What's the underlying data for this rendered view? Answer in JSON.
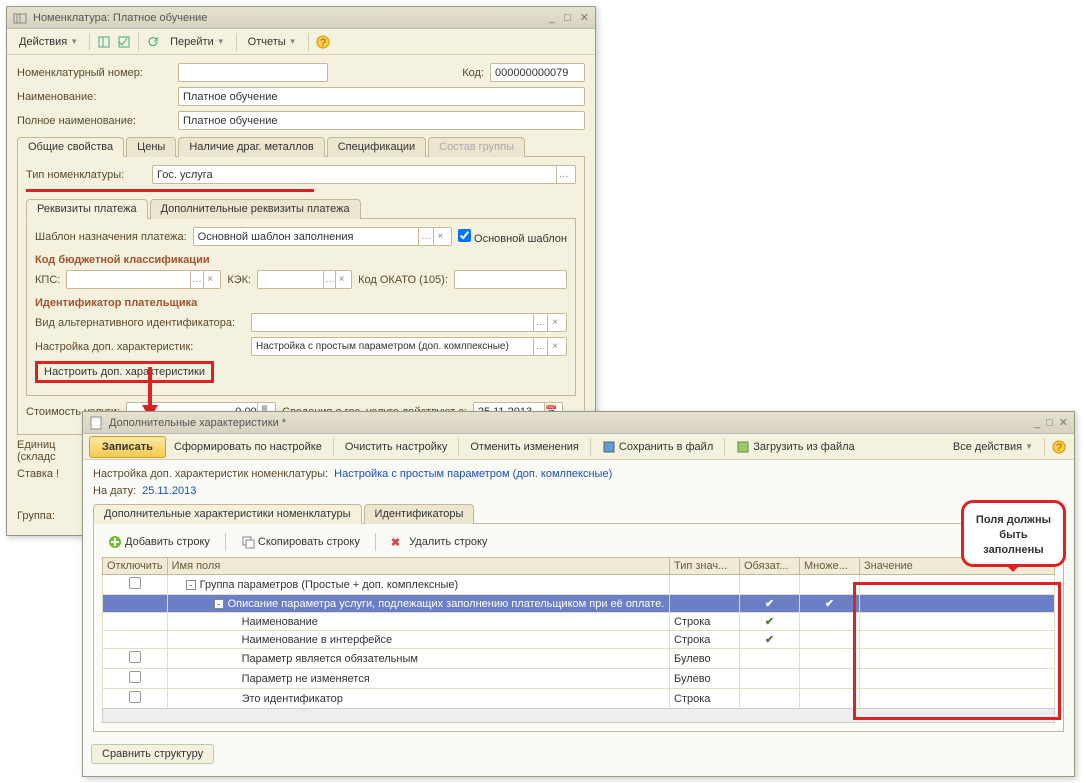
{
  "win1": {
    "title": "Номенклатура: Платное обучение",
    "toolbar": {
      "actions": "Действия",
      "goto": "Перейти",
      "reports": "Отчеты"
    },
    "fields": {
      "nom_num_lbl": "Номенклатурный номер:",
      "code_lbl": "Код:",
      "code_val": "000000000079",
      "name_lbl": "Наименование:",
      "name_val": "Платное обучение",
      "fullname_lbl": "Полное наименование:",
      "fullname_val": "Платное обучение"
    },
    "tabs": [
      "Общие свойства",
      "Цены",
      "Наличие драг. металлов",
      "Спецификации",
      "Состав группы"
    ],
    "type_lbl": "Тип номенклатуры:",
    "type_val": "Гос. услуга",
    "inner_tabs": [
      "Реквизиты платежа",
      "Дополнительные реквизиты платежа"
    ],
    "tmpl_lbl": "Шаблон назначения платежа:",
    "tmpl_val": "Основной шаблон заполнения",
    "tmpl_chk": "Основной шаблон",
    "kbk_title": "Код бюджетной классификации",
    "kps_lbl": "КПС:",
    "kek_lbl": "КЭК:",
    "okato_lbl": "Код ОКАТО (105):",
    "payer_title": "Идентификатор плательщика",
    "altid_lbl": "Вид альтернативного идентификатора:",
    "addchar_lbl": "Настройка доп. характеристик:",
    "addchar_val": "Настройка с простым параметром (доп. комлпексные)",
    "cfg_btn": "Настроить доп. характеристики",
    "cost_lbl": "Стоимость услуги:",
    "cost_val": "0,00",
    "info_lbl": "Сведения о гос. услуге действуют с:",
    "info_date": "25.11.2013",
    "unit_lbl": "Единиц\n(складс",
    "rate_lbl": "Ставка !",
    "group_lbl": "Группа:"
  },
  "win2": {
    "title": "Дополнительные характеристики *",
    "toolbar": {
      "save": "Записать",
      "form": "Сформировать по настройке",
      "clear": "Очистить настройку",
      "cancel": "Отменить изменения",
      "tofile": "Сохранить в файл",
      "fromfile": "Загрузить из файла",
      "allactions": "Все действия"
    },
    "header_lbl": "Настройка доп. характеристик номенклатуры:",
    "header_link": "Настройка с простым параметром (доп. комлпексные)",
    "date_lbl": "На дату:",
    "date_val": "25.11.2013",
    "tabs": [
      "Дополнительные характеристики номенклатуры",
      "Идентификаторы"
    ],
    "rowtools": {
      "add": "Добавить строку",
      "copy": "Скопировать строку",
      "del": "Удалить строку"
    },
    "cols": [
      "Отключить",
      "Имя поля",
      "Тип знач...",
      "Обязат...",
      "Множе...",
      "Значение"
    ],
    "rows": [
      {
        "indent": 0,
        "tree": "-",
        "name": "Группа параметров (Простые + доп. комплексные)",
        "type": "",
        "req": "",
        "mult": "",
        "disable": true
      },
      {
        "indent": 1,
        "tree": "-",
        "name": "Описание параметра услуги, подлежащих заполнению плательщиком при её оплате.",
        "type": "",
        "req": "✔",
        "mult": "✔",
        "sel": true,
        "disable": false
      },
      {
        "indent": 2,
        "name": "Наименование",
        "type": "Строка",
        "req": "✔",
        "mult": "",
        "disable": false
      },
      {
        "indent": 2,
        "name": "Наименование в интерфейсе",
        "type": "Строка",
        "req": "✔",
        "mult": "",
        "disable": false
      },
      {
        "indent": 2,
        "name": "Параметр является обязательным",
        "type": "Булево",
        "req": "",
        "mult": "",
        "disable": true
      },
      {
        "indent": 2,
        "name": "Параметр не изменяется",
        "type": "Булево",
        "req": "",
        "mult": "",
        "disable": true
      },
      {
        "indent": 2,
        "name": "Это идентификатор",
        "type": "Строка",
        "req": "",
        "mult": "",
        "disable": true
      }
    ],
    "compare_btn": "Сравнить структуру",
    "callout": "Поля должны\nбыть\nзаполнены"
  }
}
